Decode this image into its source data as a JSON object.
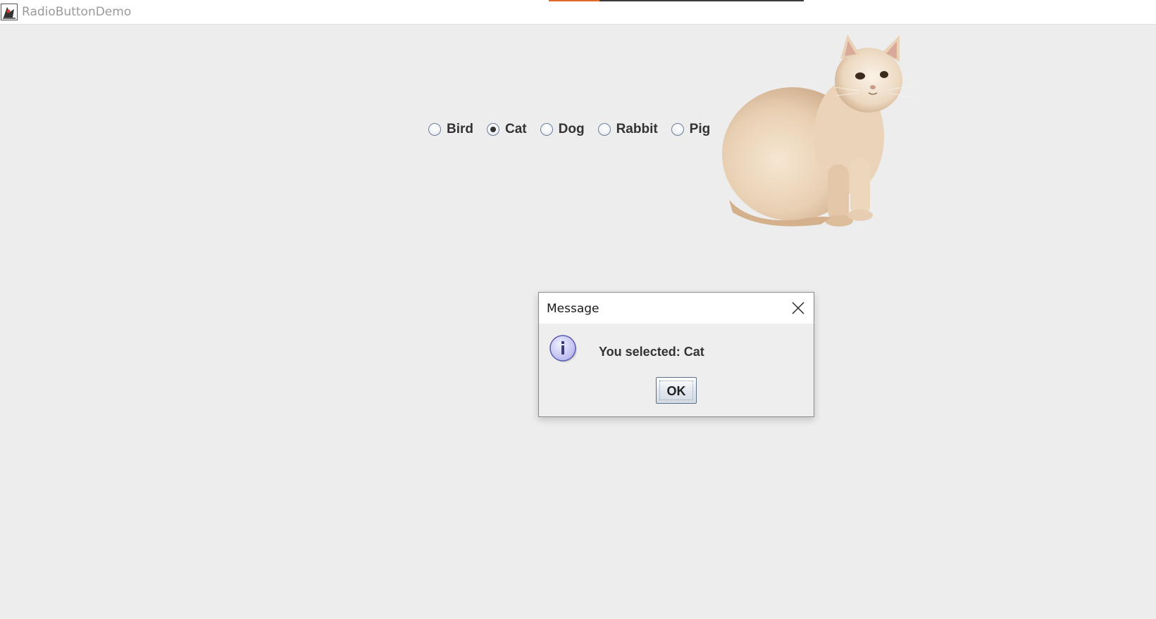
{
  "window": {
    "title": "RadioButtonDemo",
    "app_icon": "java-duke-icon"
  },
  "progress": {
    "value": 0.2
  },
  "colors": {
    "background": "#ededed",
    "progress_accent": "#e06b2c",
    "text": "#333333"
  },
  "radio_group": {
    "options": [
      {
        "label": "Bird",
        "selected": false
      },
      {
        "label": "Cat",
        "selected": true
      },
      {
        "label": "Dog",
        "selected": false
      },
      {
        "label": "Rabbit",
        "selected": false
      },
      {
        "label": "Pig",
        "selected": false
      }
    ]
  },
  "pet_image": {
    "subject": "cat"
  },
  "dialog": {
    "title": "Message",
    "icon": "information-icon",
    "message": "You selected: Cat",
    "ok_label": "OK",
    "close_icon": "close-icon"
  }
}
